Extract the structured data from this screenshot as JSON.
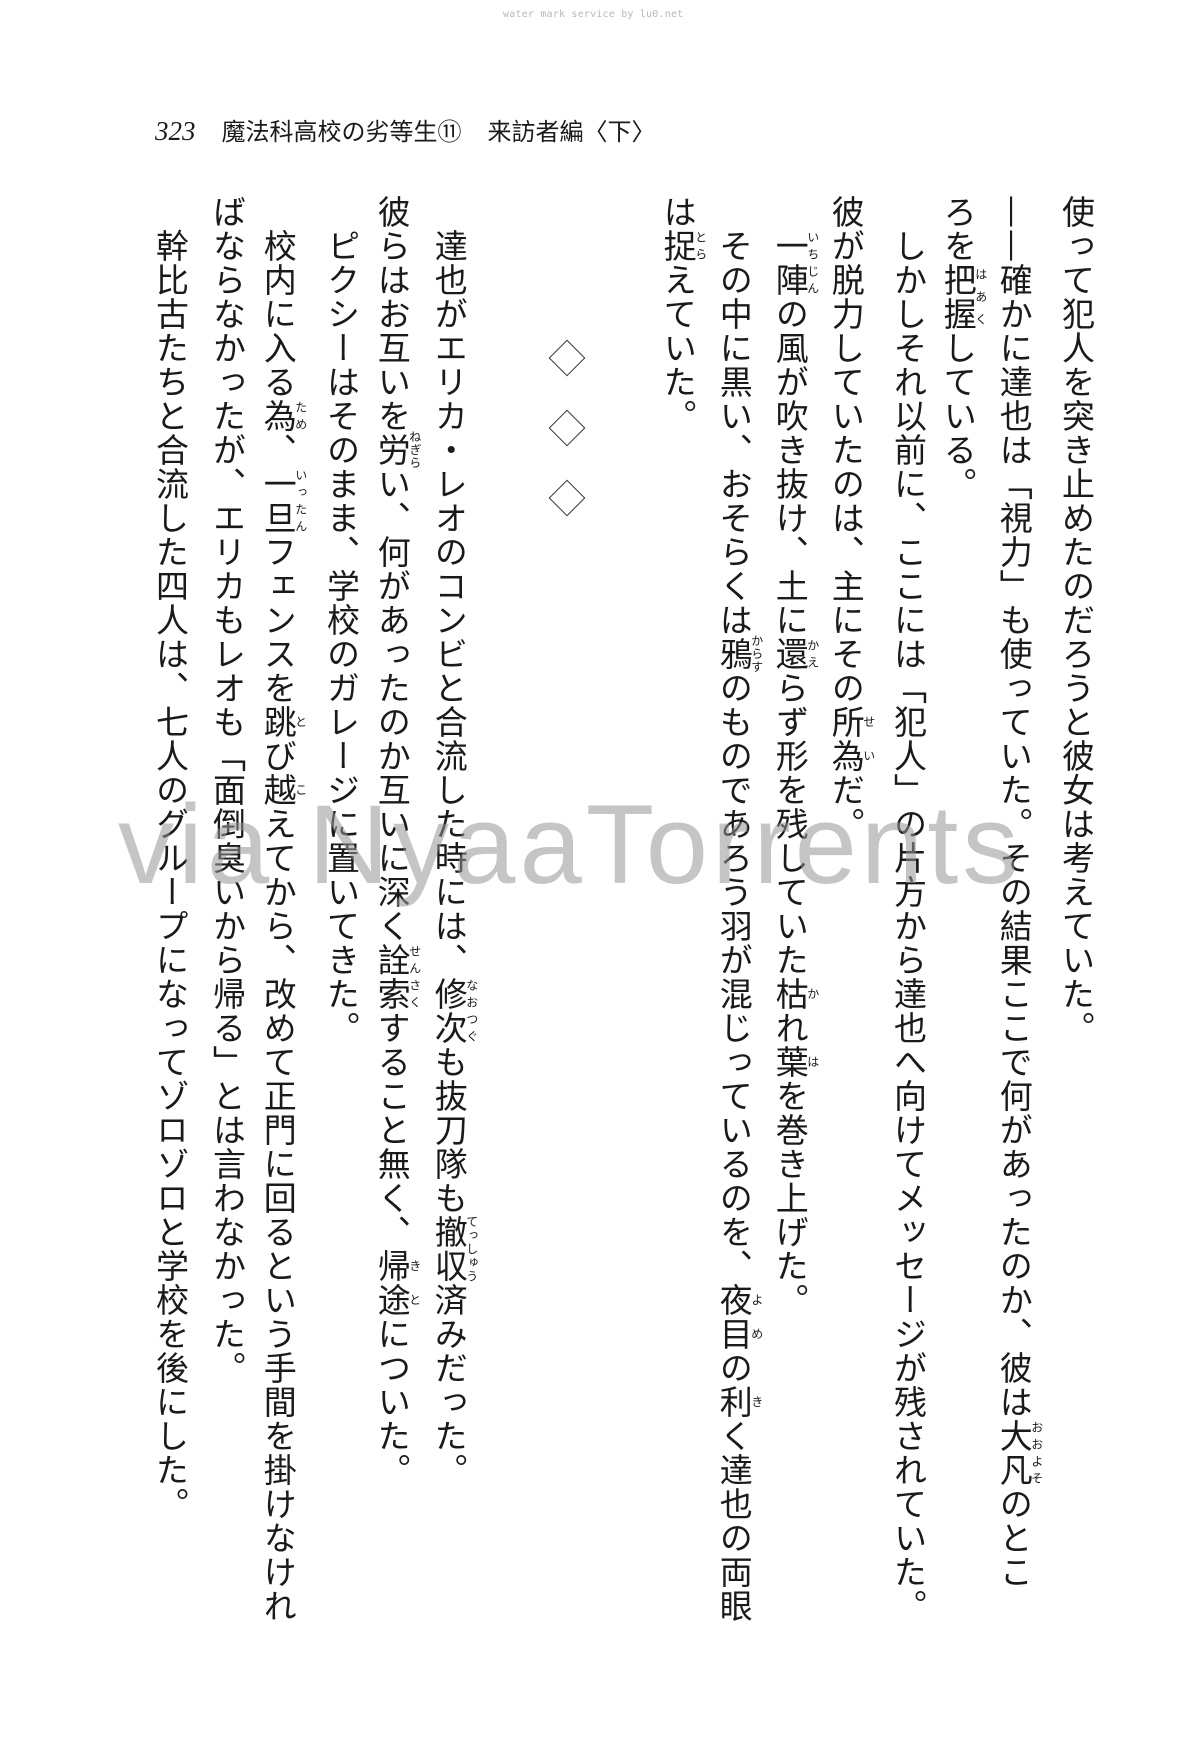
{
  "watermark_top": "water mark service by lu0.net",
  "watermark_main": "via NyaaTorrents",
  "header": {
    "page_number": "323",
    "title": "魔法科高校の劣等生⑪",
    "subtitle": "来訪者編〈下〉"
  },
  "right_block": [
    [
      [
        "使って犯人を突き止めたのだろうと彼女は考えていた。"
      ]
    ],
    [
      [
        "——確かに達也は「視力」も使っていた。その結果ここで何があったのか、彼は"
      ],
      [
        "大凡",
        "おおよそ"
      ],
      [
        "のとこ"
      ]
    ],
    [
      [
        "ろを"
      ],
      [
        "把握",
        "はあく"
      ],
      [
        "している。"
      ]
    ],
    [
      [
        "　しかしそれ以前に、ここには「犯人」の片方から達也へ向けてメッセージが残されていた。"
      ]
    ],
    [
      [
        "彼が脱力していたのは、主にその"
      ],
      [
        "所為",
        "せい"
      ],
      [
        "だ。"
      ]
    ],
    [
      [
        "　"
      ],
      [
        "一陣",
        "いちじん"
      ],
      [
        "の風が吹き抜け、土に"
      ],
      [
        "還",
        "かえ"
      ],
      [
        "らず形を残していた"
      ],
      [
        "枯",
        "か"
      ],
      [
        "れ"
      ],
      [
        "葉",
        "は"
      ],
      [
        "を巻き上げた。"
      ]
    ],
    [
      [
        "　その中に黒い、おそらくは"
      ],
      [
        "鴉",
        "からす"
      ],
      [
        "のものであろう羽が混じっているのを、"
      ],
      [
        "夜目",
        "よめ"
      ],
      [
        "の"
      ],
      [
        "利",
        "き"
      ],
      [
        "く達也の両眼"
      ]
    ],
    [
      [
        "は"
      ],
      [
        "捉",
        "とら"
      ],
      [
        "えていた。"
      ]
    ]
  ],
  "separator": [
    "◇",
    "◇",
    "◇"
  ],
  "left_block": [
    [
      [
        "　達也がエリカ・レオのコンビと合流した時には、"
      ],
      [
        "修次",
        "なおつぐ"
      ],
      [
        "も抜刀隊も"
      ],
      [
        "撤収",
        "てっしゅう"
      ],
      [
        "済みだった。"
      ]
    ],
    [
      [
        "彼らはお互いを"
      ],
      [
        "労",
        "ねぎら"
      ],
      [
        "い、何があったのか互いに深く"
      ],
      [
        "詮索",
        "せんさく"
      ],
      [
        "すること無く、"
      ],
      [
        "帰途",
        "きと"
      ],
      [
        "についた。"
      ]
    ],
    [
      [
        "　ピクシーはそのまま、学校のガレージに置いてきた。"
      ]
    ],
    [
      [
        "　校内に入る"
      ],
      [
        "為",
        "ため"
      ],
      [
        "、"
      ],
      [
        "一旦",
        "いったん"
      ],
      [
        "フェンスを"
      ],
      [
        "跳",
        "と"
      ],
      [
        "び"
      ],
      [
        "越",
        "こ"
      ],
      [
        "えてから、改めて正門に回るという手間を掛けなけれ"
      ]
    ],
    [
      [
        "ばならなかったが、エリカもレオも「面倒臭いから帰る」とは言わなかった。"
      ]
    ],
    [
      [
        "　幹比古たちと合流した四人は、七人のグループになってゾロゾロと学校を後にした。"
      ]
    ]
  ]
}
